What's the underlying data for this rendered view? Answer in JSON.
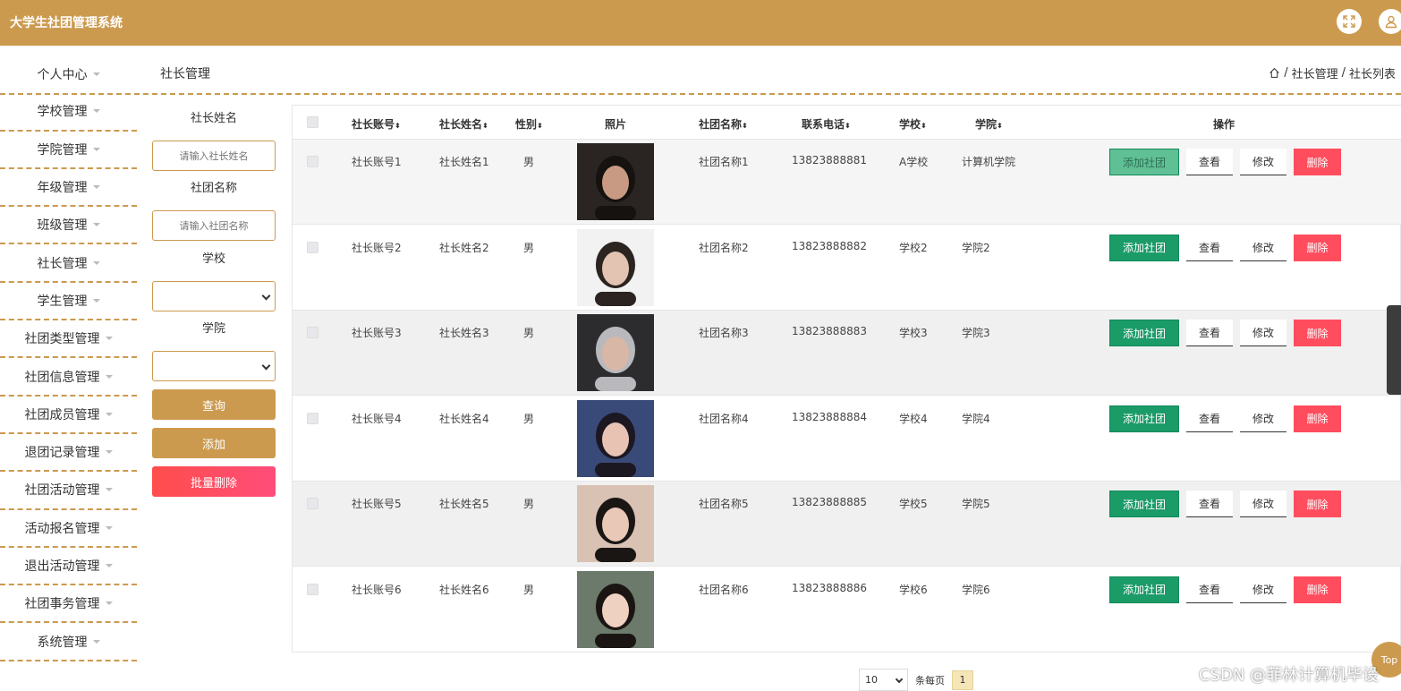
{
  "app": {
    "title": "大学生社团管理系统"
  },
  "header": {
    "icons": [
      "fullscreen-icon",
      "user-icon"
    ]
  },
  "sidebar": {
    "items": [
      {
        "label": "个人中心"
      },
      {
        "label": "学校管理"
      },
      {
        "label": "学院管理"
      },
      {
        "label": "年级管理"
      },
      {
        "label": "班级管理"
      },
      {
        "label": "社长管理"
      },
      {
        "label": "学生管理"
      },
      {
        "label": "社团类型管理"
      },
      {
        "label": "社团信息管理"
      },
      {
        "label": "社团成员管理"
      },
      {
        "label": "退团记录管理"
      },
      {
        "label": "社团活动管理"
      },
      {
        "label": "活动报名管理"
      },
      {
        "label": "退出活动管理"
      },
      {
        "label": "社团事务管理"
      },
      {
        "label": "系统管理"
      }
    ]
  },
  "page": {
    "title": "社长管理"
  },
  "breadcrumb": {
    "items": [
      "社长管理",
      "社长列表"
    ],
    "separator": "/"
  },
  "search": {
    "name_label": "社长姓名",
    "name_placeholder": "请输入社长姓名",
    "club_label": "社团名称",
    "club_placeholder": "请输入社团名称",
    "school_label": "学校",
    "college_label": "学院",
    "query_button": "查询",
    "add_button": "添加",
    "batch_delete_button": "批量删除"
  },
  "table": {
    "headers": {
      "account": "社长账号",
      "name": "社长姓名",
      "gender": "性别",
      "photo": "照片",
      "club": "社团名称",
      "phone": "联系电话",
      "school": "学校",
      "college": "学院",
      "ops": "操作"
    },
    "sort_glyph": "⬍",
    "actions": {
      "add_club": "添加社团",
      "view": "查看",
      "edit": "修改",
      "delete": "删除"
    },
    "rows": [
      {
        "account": "社长账号1",
        "name": "社长姓名1",
        "gender": "男",
        "club": "社团名称1",
        "phone": "13823888881",
        "school": "A学校",
        "college": "计算机学院"
      },
      {
        "account": "社长账号2",
        "name": "社长姓名2",
        "gender": "男",
        "club": "社团名称2",
        "phone": "13823888882",
        "school": "学校2",
        "college": "学院2"
      },
      {
        "account": "社长账号3",
        "name": "社长姓名3",
        "gender": "男",
        "club": "社团名称3",
        "phone": "13823888883",
        "school": "学校3",
        "college": "学院3"
      },
      {
        "account": "社长账号4",
        "name": "社长姓名4",
        "gender": "男",
        "club": "社团名称4",
        "phone": "13823888884",
        "school": "学校4",
        "college": "学院4"
      },
      {
        "account": "社长账号5",
        "name": "社长姓名5",
        "gender": "男",
        "club": "社团名称5",
        "phone": "13823888885",
        "school": "学校5",
        "college": "学院5"
      },
      {
        "account": "社长账号6",
        "name": "社长姓名6",
        "gender": "男",
        "club": "社团名称6",
        "phone": "13823888886",
        "school": "学校6",
        "college": "学院6"
      }
    ]
  },
  "pager": {
    "page_size": "10",
    "per_page_label": "条每页",
    "current_page": "1"
  },
  "top_button": "Top",
  "watermark": "CSDN @菲林计算机毕设",
  "colors": {
    "brand": "#cc9a4f",
    "add_club": "#1a9b68",
    "delete": "#ff4d5e"
  }
}
